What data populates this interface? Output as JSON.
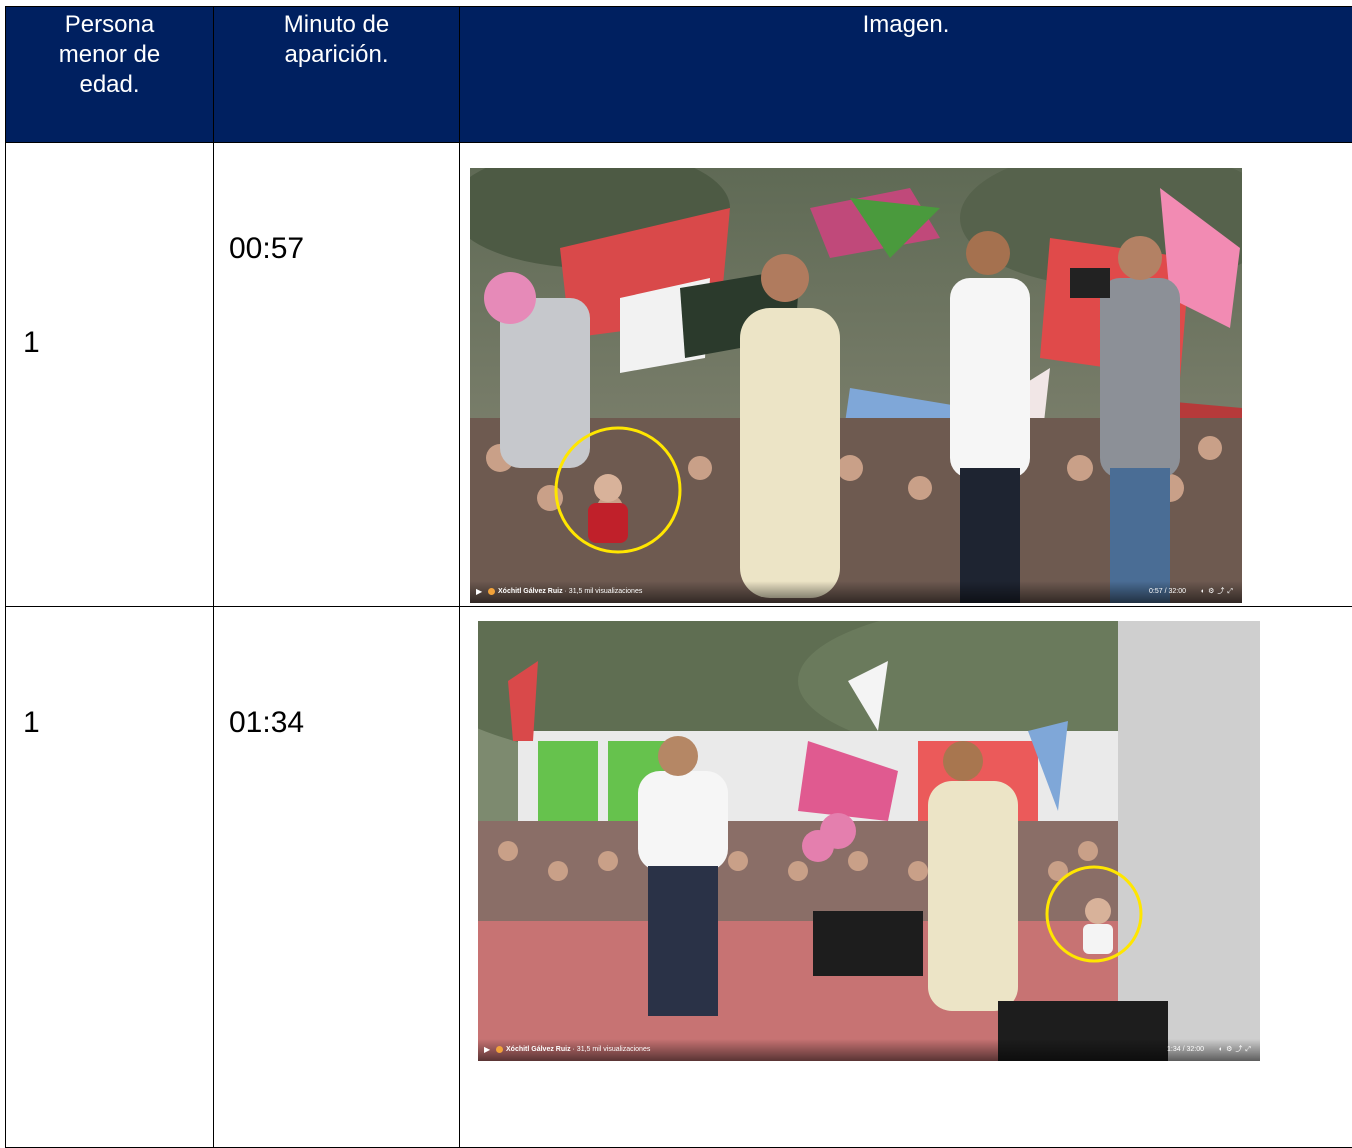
{
  "table": {
    "headers": {
      "col1": "Persona\nmenor de\nedad.",
      "col2": "Minuto de\naparición.",
      "col3": "Imagen."
    },
    "rows": [
      {
        "count": "1",
        "minute": "00:57",
        "image": {
          "description_icon": "rally-stage-photo",
          "video_bar": {
            "channel": "Xóchitl Gálvez Ruiz",
            "views": "· 31,5 mil visualizaciones",
            "time": "0:57 / 32:00"
          }
        }
      },
      {
        "count": "1",
        "minute": "01:34",
        "image": {
          "description_icon": "rally-stage-photo",
          "video_bar": {
            "channel": "Xóchitl Gálvez Ruiz",
            "views": "· 31,5 mil visualizaciones",
            "time": "1:34 / 32:00"
          }
        }
      }
    ]
  },
  "colors": {
    "header_bg": "#002060",
    "highlight_circle": "#ffe600"
  }
}
